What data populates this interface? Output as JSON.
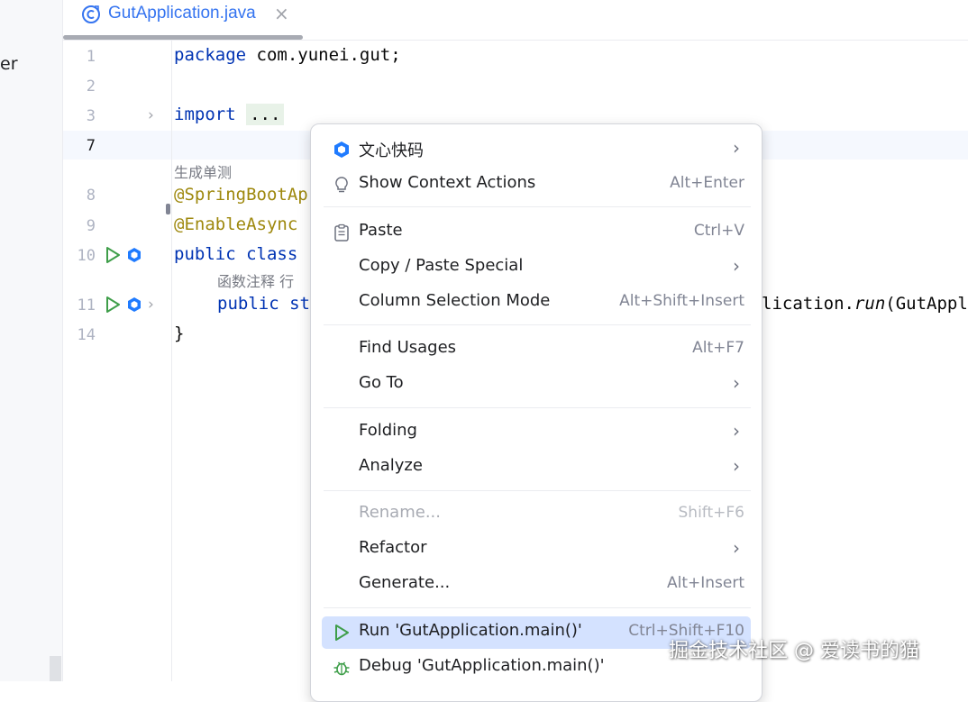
{
  "left_panel": {
    "truncated_text": "er"
  },
  "tab": {
    "label": "GutApplication.java",
    "close": "×"
  },
  "editor": {
    "line_numbers": [
      "1",
      "2",
      "3",
      "7",
      "8",
      "9",
      "10",
      "11",
      "14"
    ],
    "lines": {
      "l1_kw": "package",
      "l1_rest": " com.yunei.gut;",
      "l3_kw": "import",
      "l3_fold": "...",
      "hint_unit_test": "生成单测",
      "l8_ann": "@SpringBootAp",
      "l9_ann": "@EnableAsync",
      "l10_kw1": "public",
      "l10_kw2": "class",
      "hint_func_comment": "函数注释 行",
      "l11_kw1": "public",
      "l11_kw2": "st",
      "l11_right_pre": "lication.",
      "l11_right_method": "run",
      "l11_right_post": "(GutAppl",
      "l14": "}"
    }
  },
  "context_menu": {
    "items": [
      {
        "label": "文心快码",
        "shortcut": "",
        "submenu": true,
        "icon": "wenxin-icon"
      },
      {
        "label": "Show Context Actions",
        "shortcut": "Alt+Enter",
        "submenu": false,
        "icon": "bulb-icon"
      },
      {
        "label": "Paste",
        "shortcut": "Ctrl+V",
        "submenu": false,
        "icon": "clipboard-icon"
      },
      {
        "label": "Copy / Paste Special",
        "shortcut": "",
        "submenu": true
      },
      {
        "label": "Column Selection Mode",
        "shortcut": "Alt+Shift+Insert",
        "submenu": false
      },
      {
        "label": "Find Usages",
        "shortcut": "Alt+F7",
        "submenu": false
      },
      {
        "label": "Go To",
        "shortcut": "",
        "submenu": true
      },
      {
        "label": "Folding",
        "shortcut": "",
        "submenu": true
      },
      {
        "label": "Analyze",
        "shortcut": "",
        "submenu": true
      },
      {
        "label": "Rename...",
        "shortcut": "Shift+F6",
        "submenu": false,
        "disabled": true
      },
      {
        "label": "Refactor",
        "shortcut": "",
        "submenu": true
      },
      {
        "label": "Generate...",
        "shortcut": "Alt+Insert",
        "submenu": false
      },
      {
        "label": "Run 'GutApplication.main()'",
        "shortcut": "Ctrl+Shift+F10",
        "submenu": false,
        "icon": "run-icon",
        "selected": true
      },
      {
        "label": "Debug 'GutApplication.main()'",
        "shortcut": "",
        "submenu": false,
        "icon": "debug-icon"
      }
    ],
    "arrow_glyph": "›"
  },
  "watermark": {
    "text": "掘金技术社区 @ 爱读书的猫"
  },
  "colors": {
    "keyword": "#0033b3",
    "annotation": "#9e880d",
    "tab_accent": "#3574f0",
    "run_green": "#3f9e4a",
    "menu_selection": "#d4e2ff"
  }
}
